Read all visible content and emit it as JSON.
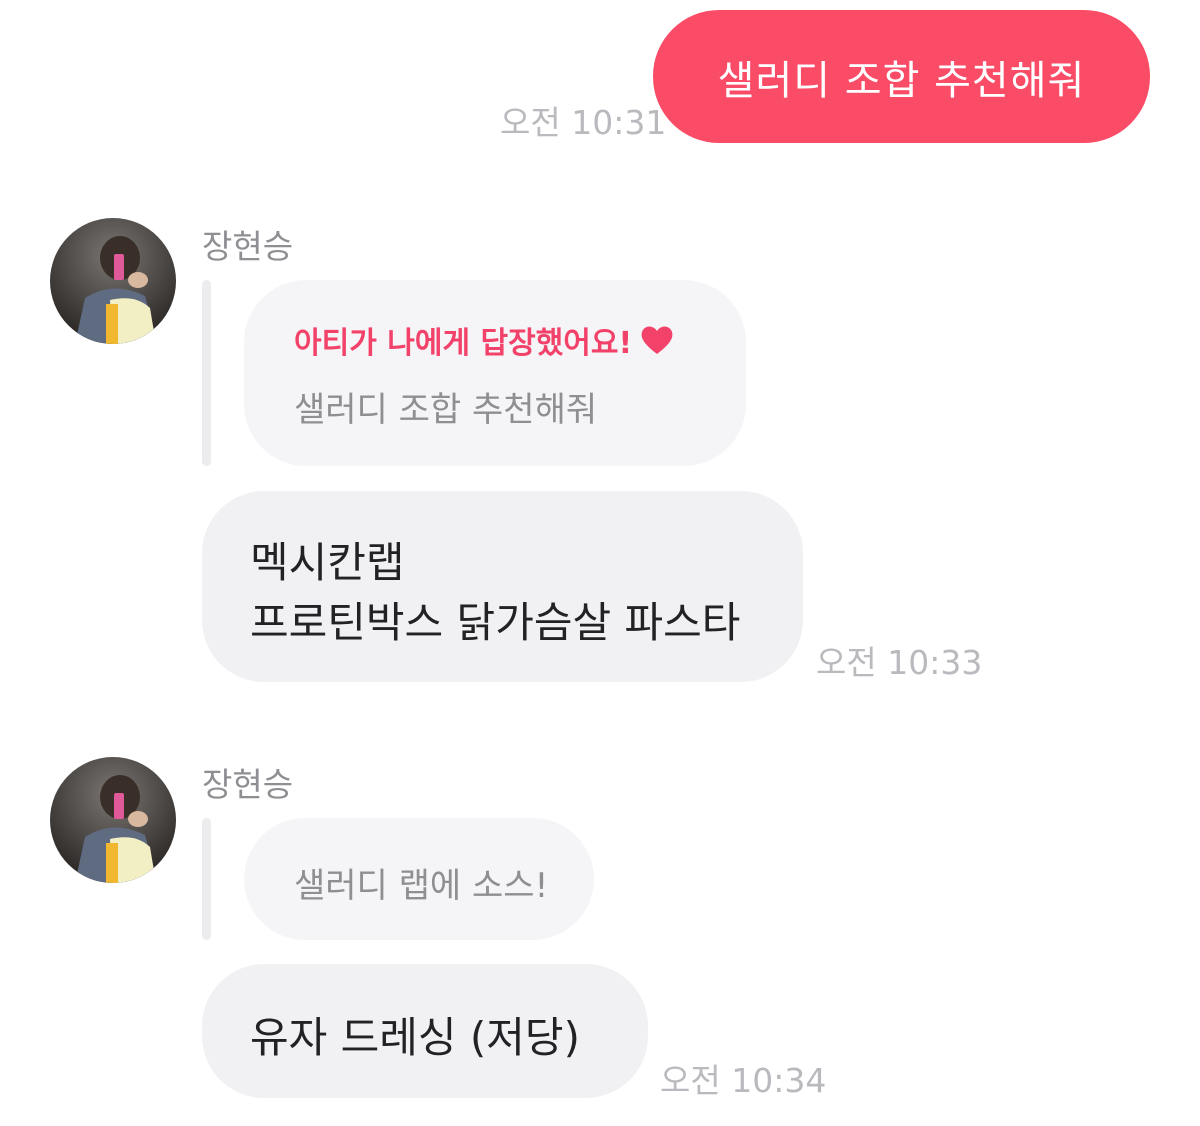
{
  "outgoing": {
    "text": "샐러디 조합 추천해줘",
    "time": "오전 10:31"
  },
  "messages": [
    {
      "sender": "장현승",
      "quote_header": "아티가 나에게 답장했어요!",
      "quote_text": "샐러디 조합 추천해줘",
      "lines": [
        "멕시칸랩",
        "프로틴박스 닭가슴살 파스타"
      ],
      "time": "오전 10:33"
    },
    {
      "sender": "장현승",
      "quote_text": "샐러디 랩에 소스!",
      "lines": [
        "유자 드레싱 (저당)"
      ],
      "time": "오전 10:34"
    }
  ],
  "colors": {
    "accent": "#fb4c67",
    "reply_header": "#f2426a",
    "incoming_bubble": "#f1f1f4",
    "quote_bubble": "#f5f5f7",
    "timestamp": "#b9b9be"
  },
  "icons": {
    "heart": "heart-icon"
  }
}
